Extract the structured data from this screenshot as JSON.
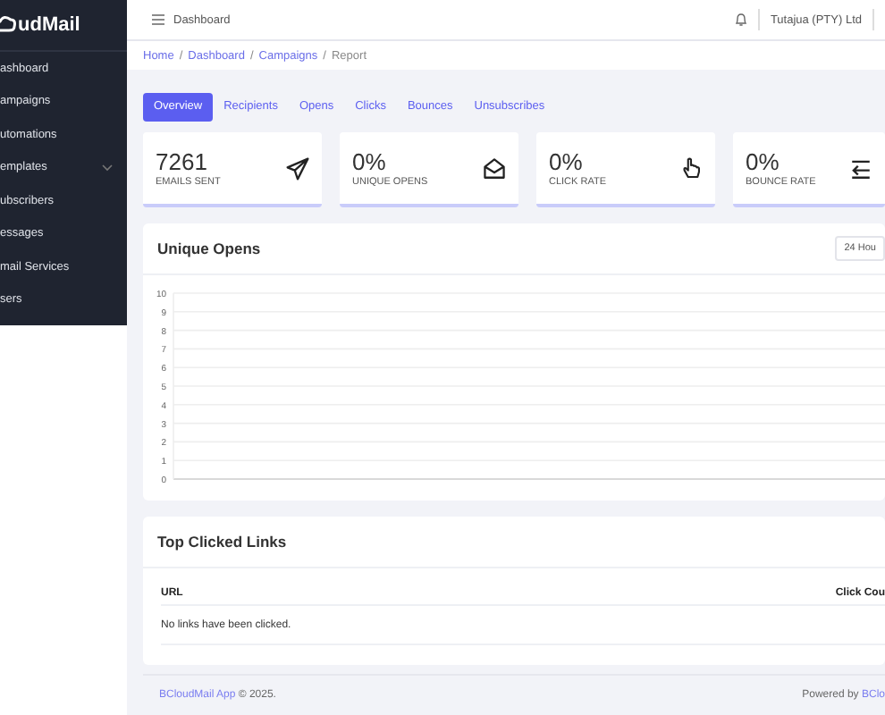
{
  "sidebar": {
    "logo": "udMail",
    "items": [
      {
        "label": "ashboard",
        "expandable": false
      },
      {
        "label": "ampaigns",
        "expandable": false
      },
      {
        "label": "utomations",
        "expandable": false
      },
      {
        "label": "emplates",
        "expandable": true
      },
      {
        "label": "ubscribers",
        "expandable": false
      },
      {
        "label": "essages",
        "expandable": false
      },
      {
        "label": "mail Services",
        "expandable": false
      },
      {
        "label": "sers",
        "expandable": false
      }
    ]
  },
  "header": {
    "title": "Dashboard",
    "account": "Tutajua (PTY) Ltd"
  },
  "breadcrumb": [
    {
      "label": "Home",
      "link": true
    },
    {
      "separator": "/",
      "label": "Dashboard",
      "link": true
    },
    {
      "separator": "/",
      "label": "Campaigns",
      "link": true
    },
    {
      "separator": "/",
      "label": "Report",
      "link": false
    }
  ],
  "tabs": [
    {
      "label": "Overview",
      "selected": true
    },
    {
      "label": "Recipients",
      "selected": false
    },
    {
      "label": "Opens",
      "selected": false
    },
    {
      "label": "Clicks",
      "selected": false
    },
    {
      "label": "Bounces",
      "selected": false
    },
    {
      "label": "Unsubscribes",
      "selected": false
    }
  ],
  "stats": [
    {
      "value": "7261",
      "label": "EMAILS SENT",
      "kind": "sent"
    },
    {
      "value": "0%",
      "label": "UNIQUE OPENS",
      "kind": "opens"
    },
    {
      "value": "0%",
      "label": "CLICK RATE",
      "kind": "clicks"
    },
    {
      "value": "0%",
      "label": "BOUNCE RATE",
      "kind": "bounces"
    }
  ],
  "unique_opens": {
    "title": "Unique Opens",
    "range": "24 Hou",
    "y_axis_labels": [
      "10",
      "9",
      "8",
      "7",
      "6",
      "5",
      "4",
      "3",
      "2",
      "1",
      "0"
    ]
  },
  "top_clicked_links": {
    "title": "Top Clicked Links",
    "columns": [
      "URL",
      "Click Cou"
    ],
    "empty_message": "No links have been clicked."
  },
  "footer": {
    "link": "BCloudMail App",
    "text": "© 2025.",
    "powered_by": "Powered by",
    "powered_link": "BClo"
  }
}
